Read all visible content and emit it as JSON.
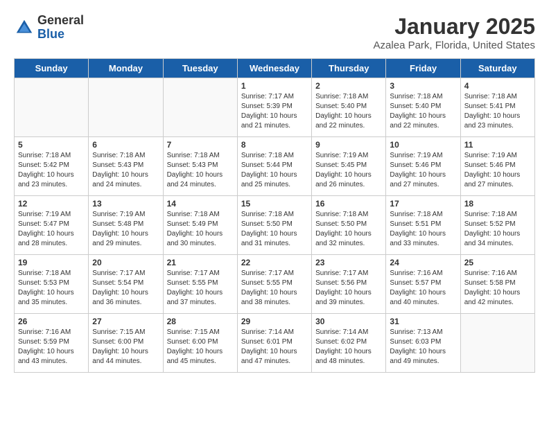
{
  "header": {
    "logo_general": "General",
    "logo_blue": "Blue",
    "title": "January 2025",
    "subtitle": "Azalea Park, Florida, United States"
  },
  "days_of_week": [
    "Sunday",
    "Monday",
    "Tuesday",
    "Wednesday",
    "Thursday",
    "Friday",
    "Saturday"
  ],
  "weeks": [
    [
      {
        "day": "",
        "info": ""
      },
      {
        "day": "",
        "info": ""
      },
      {
        "day": "",
        "info": ""
      },
      {
        "day": "1",
        "info": "Sunrise: 7:17 AM\nSunset: 5:39 PM\nDaylight: 10 hours and 21 minutes."
      },
      {
        "day": "2",
        "info": "Sunrise: 7:18 AM\nSunset: 5:40 PM\nDaylight: 10 hours and 22 minutes."
      },
      {
        "day": "3",
        "info": "Sunrise: 7:18 AM\nSunset: 5:40 PM\nDaylight: 10 hours and 22 minutes."
      },
      {
        "day": "4",
        "info": "Sunrise: 7:18 AM\nSunset: 5:41 PM\nDaylight: 10 hours and 23 minutes."
      }
    ],
    [
      {
        "day": "5",
        "info": "Sunrise: 7:18 AM\nSunset: 5:42 PM\nDaylight: 10 hours and 23 minutes."
      },
      {
        "day": "6",
        "info": "Sunrise: 7:18 AM\nSunset: 5:43 PM\nDaylight: 10 hours and 24 minutes."
      },
      {
        "day": "7",
        "info": "Sunrise: 7:18 AM\nSunset: 5:43 PM\nDaylight: 10 hours and 24 minutes."
      },
      {
        "day": "8",
        "info": "Sunrise: 7:18 AM\nSunset: 5:44 PM\nDaylight: 10 hours and 25 minutes."
      },
      {
        "day": "9",
        "info": "Sunrise: 7:19 AM\nSunset: 5:45 PM\nDaylight: 10 hours and 26 minutes."
      },
      {
        "day": "10",
        "info": "Sunrise: 7:19 AM\nSunset: 5:46 PM\nDaylight: 10 hours and 27 minutes."
      },
      {
        "day": "11",
        "info": "Sunrise: 7:19 AM\nSunset: 5:46 PM\nDaylight: 10 hours and 27 minutes."
      }
    ],
    [
      {
        "day": "12",
        "info": "Sunrise: 7:19 AM\nSunset: 5:47 PM\nDaylight: 10 hours and 28 minutes."
      },
      {
        "day": "13",
        "info": "Sunrise: 7:19 AM\nSunset: 5:48 PM\nDaylight: 10 hours and 29 minutes."
      },
      {
        "day": "14",
        "info": "Sunrise: 7:18 AM\nSunset: 5:49 PM\nDaylight: 10 hours and 30 minutes."
      },
      {
        "day": "15",
        "info": "Sunrise: 7:18 AM\nSunset: 5:50 PM\nDaylight: 10 hours and 31 minutes."
      },
      {
        "day": "16",
        "info": "Sunrise: 7:18 AM\nSunset: 5:50 PM\nDaylight: 10 hours and 32 minutes."
      },
      {
        "day": "17",
        "info": "Sunrise: 7:18 AM\nSunset: 5:51 PM\nDaylight: 10 hours and 33 minutes."
      },
      {
        "day": "18",
        "info": "Sunrise: 7:18 AM\nSunset: 5:52 PM\nDaylight: 10 hours and 34 minutes."
      }
    ],
    [
      {
        "day": "19",
        "info": "Sunrise: 7:18 AM\nSunset: 5:53 PM\nDaylight: 10 hours and 35 minutes."
      },
      {
        "day": "20",
        "info": "Sunrise: 7:17 AM\nSunset: 5:54 PM\nDaylight: 10 hours and 36 minutes."
      },
      {
        "day": "21",
        "info": "Sunrise: 7:17 AM\nSunset: 5:55 PM\nDaylight: 10 hours and 37 minutes."
      },
      {
        "day": "22",
        "info": "Sunrise: 7:17 AM\nSunset: 5:55 PM\nDaylight: 10 hours and 38 minutes."
      },
      {
        "day": "23",
        "info": "Sunrise: 7:17 AM\nSunset: 5:56 PM\nDaylight: 10 hours and 39 minutes."
      },
      {
        "day": "24",
        "info": "Sunrise: 7:16 AM\nSunset: 5:57 PM\nDaylight: 10 hours and 40 minutes."
      },
      {
        "day": "25",
        "info": "Sunrise: 7:16 AM\nSunset: 5:58 PM\nDaylight: 10 hours and 42 minutes."
      }
    ],
    [
      {
        "day": "26",
        "info": "Sunrise: 7:16 AM\nSunset: 5:59 PM\nDaylight: 10 hours and 43 minutes."
      },
      {
        "day": "27",
        "info": "Sunrise: 7:15 AM\nSunset: 6:00 PM\nDaylight: 10 hours and 44 minutes."
      },
      {
        "day": "28",
        "info": "Sunrise: 7:15 AM\nSunset: 6:00 PM\nDaylight: 10 hours and 45 minutes."
      },
      {
        "day": "29",
        "info": "Sunrise: 7:14 AM\nSunset: 6:01 PM\nDaylight: 10 hours and 47 minutes."
      },
      {
        "day": "30",
        "info": "Sunrise: 7:14 AM\nSunset: 6:02 PM\nDaylight: 10 hours and 48 minutes."
      },
      {
        "day": "31",
        "info": "Sunrise: 7:13 AM\nSunset: 6:03 PM\nDaylight: 10 hours and 49 minutes."
      },
      {
        "day": "",
        "info": ""
      }
    ]
  ]
}
